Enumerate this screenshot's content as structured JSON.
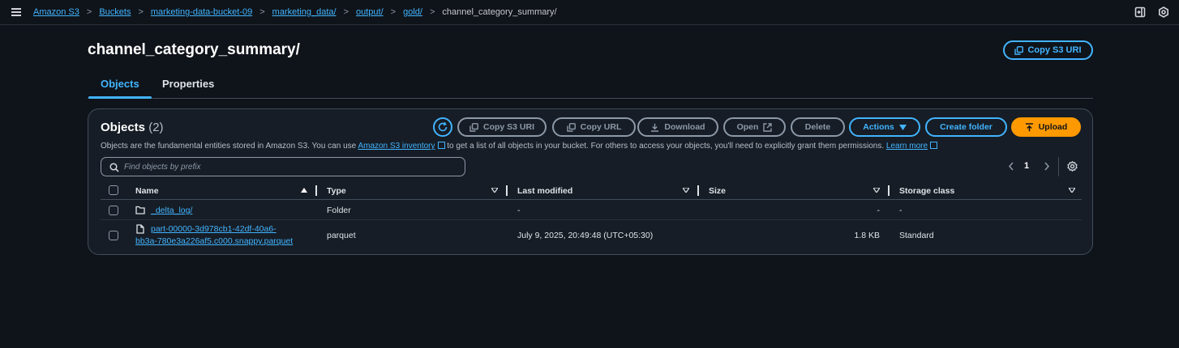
{
  "breadcrumb": {
    "items": [
      "Amazon S3",
      "Buckets",
      "marketing-data-bucket-09",
      "marketing_data/",
      "output/",
      "gold/"
    ],
    "current": "channel_category_summary/"
  },
  "header": {
    "title": "channel_category_summary/",
    "copy_s3_uri": "Copy S3 URI"
  },
  "tabs": [
    {
      "label": "Objects",
      "active": true
    },
    {
      "label": "Properties",
      "active": false
    }
  ],
  "objects_panel": {
    "title": "Objects",
    "count": "(2)",
    "description_prefix": "Objects are the fundamental entities stored in Amazon S3. You can use",
    "inventory_link": "Amazon S3 inventory",
    "description_middle": "to get a list of all objects in your bucket. For others to access your objects, you'll need to explicitly grant them permissions.",
    "learn_more": "Learn more",
    "buttons": {
      "copy_s3_uri": "Copy S3 URI",
      "copy_url": "Copy URL",
      "download": "Download",
      "open": "Open",
      "delete": "Delete",
      "actions": "Actions",
      "create_folder": "Create folder",
      "upload": "Upload"
    },
    "search_placeholder": "Find objects by prefix",
    "page_number": "1",
    "columns": [
      "Name",
      "Type",
      "Last modified",
      "Size",
      "Storage class"
    ],
    "rows": [
      {
        "name": "_delta_log/",
        "type": "Folder",
        "last_modified": "-",
        "size": "-",
        "storage_class": "-",
        "icon": "folder-icon"
      },
      {
        "name_line1": "part-00000-3d978cb1-42df-40a6-",
        "name_line2": "bb3a-780e3a226af5.c000.snappy.parquet",
        "type": "parquet",
        "last_modified": "July 9, 2025, 20:49:48 (UTC+05:30)",
        "size": "1.8 KB",
        "storage_class": "Standard",
        "icon": "file-icon"
      }
    ]
  },
  "colors": {
    "accent": "#42b4ff",
    "upload": "#ff9900",
    "background": "#0f141a"
  }
}
